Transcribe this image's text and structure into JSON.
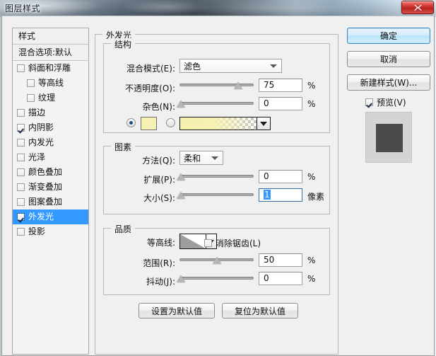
{
  "window": {
    "title": "图层样式",
    "close_label": "×",
    "close_icon": "close-icon"
  },
  "style_list": {
    "header": "样式",
    "blending_options": "混合选项:默认",
    "effects": [
      {
        "label": "斜面和浮雕",
        "checked": false,
        "indent": false,
        "selected": false
      },
      {
        "label": "等高线",
        "checked": false,
        "indent": true,
        "selected": false
      },
      {
        "label": "纹理",
        "checked": false,
        "indent": true,
        "selected": false
      },
      {
        "label": "描边",
        "checked": false,
        "indent": false,
        "selected": false
      },
      {
        "label": "内阴影",
        "checked": true,
        "indent": false,
        "selected": false
      },
      {
        "label": "内发光",
        "checked": false,
        "indent": false,
        "selected": false
      },
      {
        "label": "光泽",
        "checked": false,
        "indent": false,
        "selected": false
      },
      {
        "label": "颜色叠加",
        "checked": false,
        "indent": false,
        "selected": false
      },
      {
        "label": "渐变叠加",
        "checked": false,
        "indent": false,
        "selected": false
      },
      {
        "label": "图案叠加",
        "checked": false,
        "indent": false,
        "selected": false
      },
      {
        "label": "外发光",
        "checked": true,
        "indent": false,
        "selected": true
      },
      {
        "label": "投影",
        "checked": false,
        "indent": false,
        "selected": false
      }
    ]
  },
  "main": {
    "panel_title": "外发光",
    "structure": {
      "legend": "结构",
      "blend_mode_label": "混合模式(E):",
      "blend_mode_value": "滤色",
      "opacity_label": "不透明度(O):",
      "opacity_value": "75",
      "opacity_unit": "%",
      "noise_label": "杂色(N):",
      "noise_value": "0",
      "noise_unit": "%",
      "color_selected": true,
      "color_hex": "#f7f0b4",
      "gradient_from": "#f6f0ae",
      "gradient_to": "transparent"
    },
    "elements": {
      "legend": "图素",
      "technique_label": "方法(Q):",
      "technique_value": "柔和",
      "spread_label": "扩展(P):",
      "spread_value": "0",
      "spread_unit": "%",
      "size_label": "大小(S):",
      "size_value": "1",
      "size_unit": "像素"
    },
    "quality": {
      "legend": "品质",
      "contour_label": "等高线:",
      "antialias_label": "消除锯齿(L)",
      "antialias_checked": false,
      "range_label": "范围(R):",
      "range_value": "50",
      "range_unit": "%",
      "jitter_label": "抖动(J):",
      "jitter_value": "0",
      "jitter_unit": "%"
    },
    "set_default_label": "设置为默认值",
    "reset_default_label": "复位为默认值"
  },
  "right": {
    "ok_label": "确定",
    "cancel_label": "取消",
    "new_style_label": "新建样式(W)...",
    "preview_label": "预览(V)",
    "preview_checked": true
  },
  "colors": {
    "accent": "#3399ff",
    "close_red": "#c32a25",
    "dialog_bg": "#f0f0f0"
  }
}
